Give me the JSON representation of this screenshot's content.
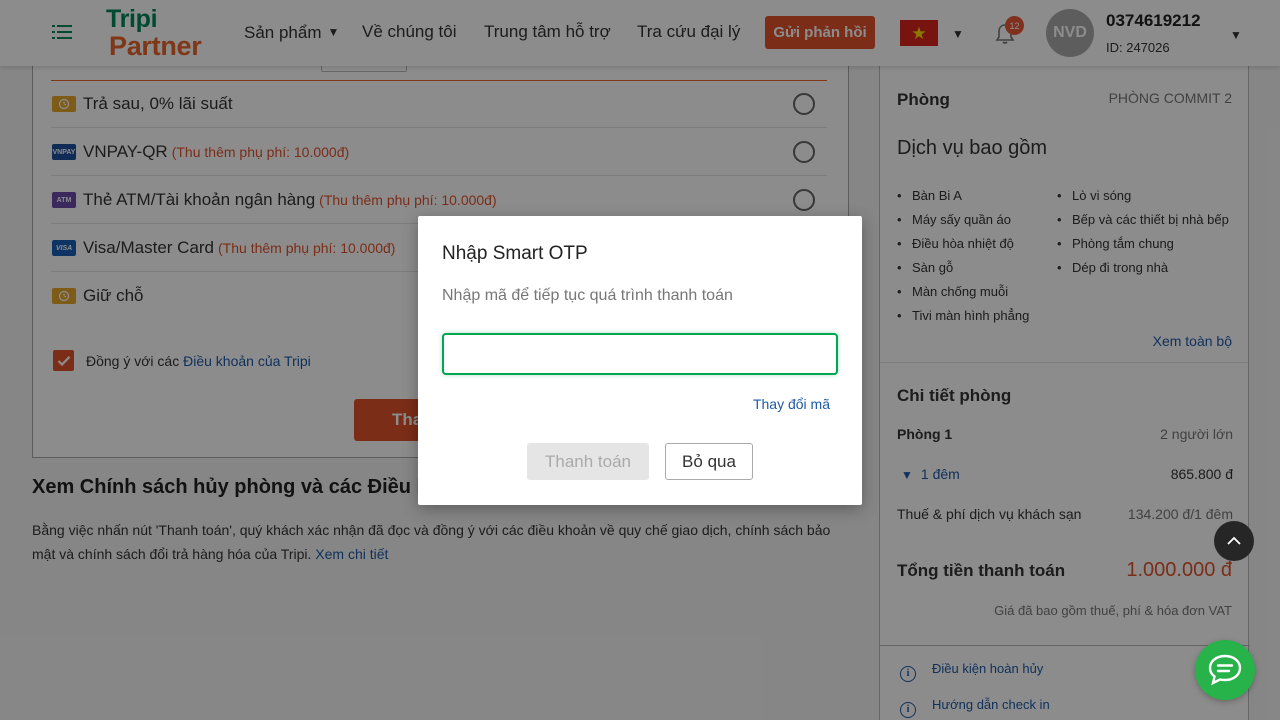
{
  "header": {
    "logo_line1": "Tripi",
    "logo_line2": "Partner",
    "nav": {
      "products": "Sản phẩm",
      "about": "Về chúng tôi",
      "support": "Trung tâm hỗ trợ",
      "agency_lookup": "Tra cứu đại lý"
    },
    "caret": "▼",
    "feedback_label": "Gửi phản hồi",
    "flag_star": "★",
    "notification_count": "12",
    "user": {
      "initials": "NVD",
      "phone": "0374619212",
      "id": "ID: 247026"
    }
  },
  "payment": {
    "methods": [
      {
        "label": "Trả sau, 0% lãi suất",
        "fee": "",
        "icon": "wallet-icon",
        "color": "#e6a72b"
      },
      {
        "label": "VNPAY-QR",
        "fee": "(Thu thêm phụ phí: 10.000đ)",
        "icon": "vnpay-icon",
        "color": "#1e4f9c"
      },
      {
        "label": "Thẻ ATM/Tài khoản ngân hàng",
        "fee": "(Thu thêm phụ phí: 10.000đ)",
        "icon": "atm-card-icon",
        "color": "#6c4aa8"
      },
      {
        "label": "Visa/Master Card",
        "fee": "(Thu thêm phụ phí: 10.000đ)",
        "icon": "visa-card-icon",
        "color": "#1a5fb4"
      },
      {
        "label": "Giữ chỗ",
        "fee": "",
        "icon": "hold-icon",
        "color": "#e6a72b"
      }
    ],
    "icon_text": {
      "vnpay": "VNPAY",
      "atm": "ATM",
      "visa": "VISA"
    },
    "agree_prefix": "Đồng ý với các",
    "agree_link": "Điều khoản của Tripi",
    "agree_checked": true,
    "submit_partial": "Tha"
  },
  "policy": {
    "title": "Xem Chính sách hủy phòng và các Điều kiệ",
    "text": "Bằng việc nhấn nút 'Thanh toán', quý khách xác nhận đã đọc và đồng ý với các điều khoản về quy chế giao dịch, chính sách bảo mật và chính sách đổi trả hàng hóa của Tripi.",
    "link": "Xem chi tiết"
  },
  "sidebar": {
    "room_label": "Phòng",
    "room_value": "PHÒNG COMMIT 2",
    "services_title": "Dịch vụ bao gồm",
    "services_col1": [
      "Bàn Bi A",
      "Máy sấy quần áo",
      "Điều hòa nhiệt độ",
      "Sàn gỗ",
      "Màn chống muỗi",
      "Tivi màn hình phẳng"
    ],
    "services_col2": [
      "Lò vi sóng",
      "Bếp và các thiết bị nhà bếp",
      "Phòng tắm chung",
      "Dép đi trong nhà"
    ],
    "see_all": "Xem toàn bộ",
    "room_detail_title": "Chi tiết phòng",
    "room_name": "Phòng 1",
    "guests": "2 người lớn",
    "nights_toggle": "▼",
    "nights": "1 đêm",
    "nights_price": "865.800 đ",
    "tax_label": "Thuế & phí dịch vụ khách sạn",
    "tax_value": "134.200 đ/1 đêm",
    "total_label": "Tổng tiền thanh toán",
    "total_value": "1.000.000 đ",
    "vat_note": "Giá đã bao gồm thuế, phí & hóa đơn VAT",
    "link_cancel": "Điều kiện hoàn hủy",
    "link_checkin": "Hướng dẫn check in",
    "info_glyph": "i"
  },
  "modal": {
    "title": "Nhập Smart OTP",
    "subtitle": "Nhập mã để tiếp tục quá trình thanh toán",
    "otp_value": "",
    "change_code": "Thay đổi mã",
    "pay_button": "Thanh toán",
    "skip_button": "Bỏ qua"
  },
  "colors": {
    "brand_green": "#00875a",
    "brand_orange": "#e0532a",
    "link_blue": "#1e5aa8",
    "input_focus": "#00a651",
    "chat_green": "#27b24a"
  }
}
